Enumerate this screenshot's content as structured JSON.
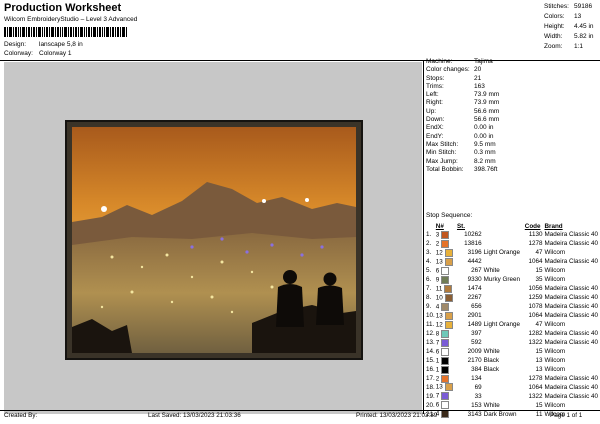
{
  "header": {
    "title": "Production Worksheet",
    "subtitle": "Wilcom EmbroideryStudio – Level 3 Advanced",
    "design_label": "Design:",
    "design_value": "lanscape 5,8 in",
    "colorway_label": "Colorway:",
    "colorway_value": "Colorway 1"
  },
  "summary": [
    {
      "k": "Stitches:",
      "v": "59186"
    },
    {
      "k": "Colors:",
      "v": "13"
    },
    {
      "k": "Height:",
      "v": "4.45 in"
    },
    {
      "k": "Width:",
      "v": "5.82 in"
    },
    {
      "k": "Zoom:",
      "v": "1:1"
    }
  ],
  "properties": [
    {
      "k": "Machine:",
      "v": "Tajima"
    },
    {
      "k": "Color changes:",
      "v": "20"
    },
    {
      "k": "Stops:",
      "v": "21"
    },
    {
      "k": "Trims:",
      "v": "163"
    },
    {
      "k": "Left:",
      "v": "73.9 mm"
    },
    {
      "k": "Right:",
      "v": "73.9 mm"
    },
    {
      "k": "Up:",
      "v": "56.6 mm"
    },
    {
      "k": "Down:",
      "v": "56.6 mm"
    },
    {
      "k": "EndX:",
      "v": "0.00 in"
    },
    {
      "k": "EndY:",
      "v": "0.00 in"
    },
    {
      "k": "Max Stitch:",
      "v": "9.5 mm"
    },
    {
      "k": "Min Stitch:",
      "v": "0.3 mm"
    },
    {
      "k": "Max Jump:",
      "v": "8.2 mm"
    },
    {
      "k": "Total Bobbin:",
      "v": "398.76ft"
    }
  ],
  "sequence": {
    "title": "Stop Sequence:",
    "headers": [
      "N#",
      "St.",
      "Code",
      "Brand"
    ],
    "rows": [
      {
        "idx": "1.",
        "n": "3",
        "color": "#c0561e",
        "st": "10262",
        "name": "",
        "code": "1130",
        "brand": "Madeira Classic 40"
      },
      {
        "idx": "2.",
        "n": "2",
        "color": "#e5732a",
        "st": "13816",
        "name": "",
        "code": "1278",
        "brand": "Madeira Classic 40"
      },
      {
        "idx": "3.",
        "n": "12",
        "color": "#e8b13a",
        "st": "3196",
        "name": "Light Orange",
        "code": "47",
        "brand": "Wilcom"
      },
      {
        "idx": "4.",
        "n": "13",
        "color": "#d9a04a",
        "st": "4442",
        "name": "",
        "code": "1064",
        "brand": "Madeira Classic 40"
      },
      {
        "idx": "5.",
        "n": "6",
        "color": "#ffffff",
        "st": "267",
        "name": "White",
        "code": "15",
        "brand": "Wilcom"
      },
      {
        "idx": "6.",
        "n": "9",
        "color": "#6f7c55",
        "st": "9330",
        "name": "Murky Green",
        "code": "35",
        "brand": "Wilcom"
      },
      {
        "idx": "7.",
        "n": "11",
        "color": "#b07a3c",
        "st": "1474",
        "name": "",
        "code": "1056",
        "brand": "Madeira Classic 40"
      },
      {
        "idx": "8.",
        "n": "10",
        "color": "#8a5e34",
        "st": "2267",
        "name": "",
        "code": "1259",
        "brand": "Madeira Classic 40"
      },
      {
        "idx": "9.",
        "n": "4",
        "color": "#a08a6a",
        "st": "656",
        "name": "",
        "code": "1078",
        "brand": "Madeira Classic 40"
      },
      {
        "idx": "10.",
        "n": "13",
        "color": "#d9a04a",
        "st": "2901",
        "name": "",
        "code": "1064",
        "brand": "Madeira Classic 40"
      },
      {
        "idx": "11.",
        "n": "12",
        "color": "#e8b13a",
        "st": "1489",
        "name": "Light Orange",
        "code": "47",
        "brand": "Wilcom"
      },
      {
        "idx": "12.",
        "n": "8",
        "color": "#6fc9b8",
        "st": "397",
        "name": "",
        "code": "1282",
        "brand": "Madeira Classic 40"
      },
      {
        "idx": "13.",
        "n": "7",
        "color": "#7a5cd6",
        "st": "592",
        "name": "",
        "code": "1322",
        "brand": "Madeira Classic 40"
      },
      {
        "idx": "14.",
        "n": "6",
        "color": "#ffffff",
        "st": "2009",
        "name": "White",
        "code": "15",
        "brand": "Wilcom"
      },
      {
        "idx": "15.",
        "n": "1",
        "color": "#000000",
        "st": "2170",
        "name": "Black",
        "code": "13",
        "brand": "Wilcom"
      },
      {
        "idx": "16.",
        "n": "1",
        "color": "#000000",
        "st": "384",
        "name": "Black",
        "code": "13",
        "brand": "Wilcom"
      },
      {
        "idx": "17.",
        "n": "2",
        "color": "#e5732a",
        "st": "134",
        "name": "",
        "code": "1278",
        "brand": "Madeira Classic 40"
      },
      {
        "idx": "18.",
        "n": "13",
        "color": "#d9a04a",
        "st": "69",
        "name": "",
        "code": "1064",
        "brand": "Madeira Classic 40"
      },
      {
        "idx": "19.",
        "n": "7",
        "color": "#7a5cd6",
        "st": "33",
        "name": "",
        "code": "1322",
        "brand": "Madeira Classic 40"
      },
      {
        "idx": "20.",
        "n": "6",
        "color": "#ffffff",
        "st": "153",
        "name": "White",
        "code": "15",
        "brand": "Wilcom"
      },
      {
        "idx": "21.",
        "n": "4",
        "color": "#3a2a1a",
        "st": "3143",
        "name": "Dark Brown",
        "code": "11",
        "brand": "Wilcom"
      }
    ]
  },
  "footer": {
    "created": "Created By:",
    "saved": "Last Saved: 13/03/2023 21:03:36",
    "printed": "Printed: 13/03/2023 21:03:39",
    "page": "Page 1 of 1"
  }
}
